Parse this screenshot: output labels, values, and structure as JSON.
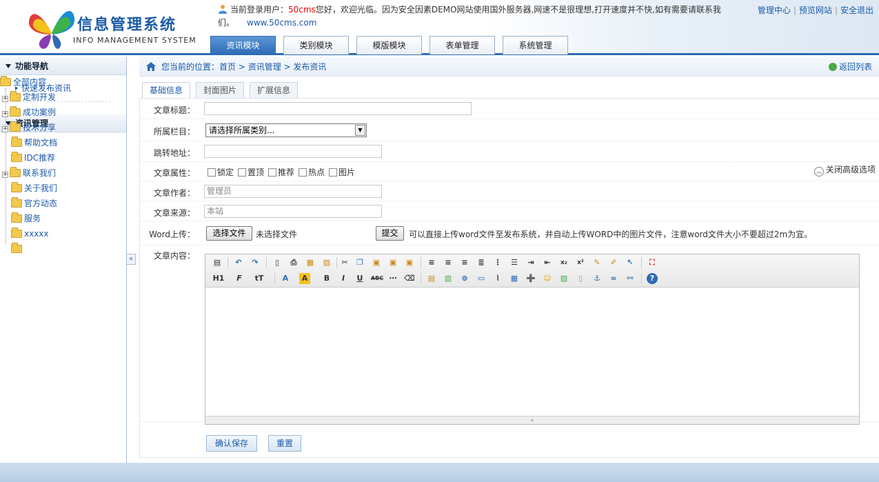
{
  "header": {
    "logo_cn": "信息管理系统",
    "logo_en": "INFO MANAGEMENT SYSTEM",
    "user_prefix": "当前登录用户：",
    "user_name": "50cms",
    "user_msg": "您好，欢迎光临。因为安全因素DEMO网站使用国外服务器,网速不是很理想,打开速度并不快,如有需要请联系我们。",
    "site_url": "www.50cms.com",
    "links": [
      "管理中心",
      "预览网站",
      "安全退出"
    ],
    "nav_tabs": [
      "资讯模块",
      "类别模块",
      "模版模块",
      "表单管理",
      "系统管理"
    ],
    "active_tab": "资讯模块"
  },
  "sidebar": {
    "section1_title": "功能导航",
    "quick_link": "快速发布资讯",
    "section2_title": "资讯管理",
    "tree_root": "全部内容",
    "tree_items": [
      "定制开发",
      "成功案例",
      "技术分享",
      "帮助文档",
      "IDC推荐",
      "联系我们",
      "关于我们",
      "官方动态",
      "服务",
      "xxxxx",
      ""
    ],
    "collapse_symbol": "«"
  },
  "breadcrumb": {
    "prefix": "您当前的位置：",
    "path": "首页 > 资讯管理 > 发布资讯",
    "back": "返回列表"
  },
  "subtabs": [
    "基础信息",
    "封面图片",
    "扩展信息"
  ],
  "form": {
    "title_label": "文章标题：",
    "title_value": "",
    "category_label": "所属栏目：",
    "category_value": "请选择所属类别...",
    "redirect_label": "跳转地址：",
    "redirect_value": "",
    "attr_label": "文章属性：",
    "attrs": [
      "锁定",
      "置顶",
      "推荐",
      "热点",
      "图片"
    ],
    "adv_toggle": "关闭高级选项",
    "author_label": "文章作者：",
    "author_value": "管理员",
    "source_label": "文章来源：",
    "source_value": "本站",
    "word_label": "Word上传：",
    "choose_file": "选择文件",
    "no_file": "未选择文件",
    "submit": "提交",
    "word_hint": "可以直接上传word文件至发布系统，并自动上传WORD中的图片文件，注意word文件大小不要超过2m为宜。",
    "content_label": "文章内容：",
    "save": "确认保存",
    "reset": "重置"
  },
  "editor_toolbar": {
    "row1": [
      "source-icon",
      "undo-icon",
      "redo-icon",
      "preview-icon",
      "print-icon",
      "template-icon",
      "code-icon",
      "cut-icon",
      "copy-icon",
      "paste-icon",
      "paste-text-icon",
      "paste-word-icon",
      "align-left-icon",
      "align-center-icon",
      "align-right-icon",
      "justify-icon",
      "ordered-list-icon",
      "unordered-list-icon",
      "indent-icon",
      "outdent-icon",
      "subscript-icon",
      "superscript-icon",
      "clear-format-icon",
      "select-all-icon",
      "select-icon",
      "fullscreen-icon"
    ],
    "row2": [
      "H1",
      "F",
      "tT",
      "A",
      "A",
      "B",
      "I",
      "U",
      "ABC"
    ]
  }
}
